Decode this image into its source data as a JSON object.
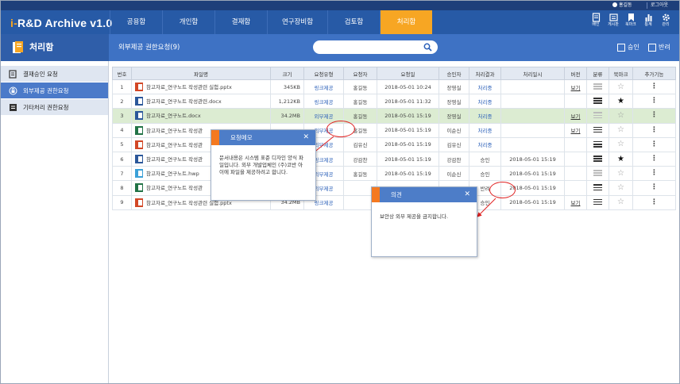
{
  "util": {
    "user": "홍길동",
    "logout": "로그아웃"
  },
  "header": {
    "logo": "i-R&D Archive v1.0",
    "tabs": [
      "공용함",
      "개인함",
      "결재함",
      "연구장비함",
      "검토함",
      "처리함"
    ],
    "tools": [
      "배인",
      "게시판",
      "북마크",
      "통계",
      "관리"
    ]
  },
  "subhead": {
    "section": "처리함",
    "page_title": "외부제공 권한요청(9)",
    "search_placeholder": "",
    "approve": "승인",
    "reject": "반려"
  },
  "sidebar": {
    "items": [
      {
        "label": "결재승인 요청",
        "icon": "approval-doc-icon"
      },
      {
        "label": "외부제공 권한요청",
        "icon": "lock-shield-icon"
      },
      {
        "label": "기타처리 권한요청",
        "icon": "list-doc-icon"
      }
    ]
  },
  "table": {
    "headers": [
      "번호",
      "파일명",
      "크기",
      "요청유형",
      "요청자",
      "요청일",
      "승인자",
      "처리결과",
      "처리일시",
      "버전",
      "분류",
      "북마크",
      "추가기능"
    ],
    "rows": [
      {
        "no": "1",
        "type": "ppt",
        "file": "참고자료_연구노트 작성관련 실험.pptx",
        "size": "345KB",
        "req_type": "링크제공",
        "requester": "홍길동",
        "req_date": "2018-05-01 10:24",
        "approver": "장영실",
        "result": "처리중",
        "proc_date": "",
        "version": "보기",
        "cls": "faint",
        "bookmark": "☆"
      },
      {
        "no": "2",
        "type": "doc",
        "file": "참고자료_연구노트 작성관련.docx",
        "size": "1,212KB",
        "req_type": "링크제공",
        "requester": "홍길동",
        "req_date": "2018-05-01 11:32",
        "approver": "장영실",
        "result": "처리중",
        "proc_date": "",
        "version": "",
        "cls": "dark",
        "bookmark": "★"
      },
      {
        "no": "3",
        "type": "doc",
        "file": "참고자료_연구노트.docx",
        "size": "34.2MB",
        "req_type": "외부제공",
        "requester": "홍길동",
        "req_date": "2018-05-01 15:19",
        "approver": "장영실",
        "result": "처리중",
        "proc_date": "",
        "version": "보기",
        "cls": "faint",
        "bookmark": "☆"
      },
      {
        "no": "4",
        "type": "xls",
        "file": "참고자료_연구노트 작성관",
        "size": "",
        "req_type": "외부제공",
        "requester": "홍길동",
        "req_date": "2018-05-01 15:19",
        "approver": "이순신",
        "result": "처리중",
        "proc_date": "",
        "version": "보기",
        "cls": "dark",
        "bookmark": "☆"
      },
      {
        "no": "5",
        "type": "ppt",
        "file": "참고자료_연구노트 작성관",
        "size": "",
        "req_type": "외부제공",
        "requester": "김유신",
        "req_date": "2018-05-01 15:19",
        "approver": "김유신",
        "result": "처리중",
        "proc_date": "",
        "version": "",
        "cls": "dark",
        "bookmark": "☆"
      },
      {
        "no": "6",
        "type": "doc",
        "file": "참고자료_연구노트 작성관",
        "size": "",
        "req_type": "링크제공",
        "requester": "강감찬",
        "req_date": "2018-05-01 15:19",
        "approver": "강감찬",
        "result": "승인",
        "proc_date": "2018-05-01 15:19",
        "version": "",
        "cls": "dark",
        "bookmark": "★"
      },
      {
        "no": "7",
        "type": "hwp",
        "file": "참고자료_연구노트.hwp",
        "size": "",
        "req_type": "외부제공",
        "requester": "홍길동",
        "req_date": "2018-05-01 15:19",
        "approver": "이순신",
        "result": "승인",
        "proc_date": "2018-05-01 15:19",
        "version": "",
        "cls": "faint",
        "bookmark": "☆"
      },
      {
        "no": "8",
        "type": "xls",
        "file": "참고자료_연구노트 작성관",
        "size": "",
        "req_type": "외부제공",
        "requester": "",
        "req_date": "",
        "approver": "",
        "result": "반려",
        "proc_date": "2018-05-01 15:19",
        "version": "",
        "cls": "dark",
        "bookmark": "☆"
      },
      {
        "no": "9",
        "type": "ppt",
        "file": "참고자료_연구노트 작성관련 실험.pptx",
        "size": "34.2MB",
        "req_type": "링크제공",
        "requester": "",
        "req_date": "",
        "approver": "",
        "result": "승인",
        "proc_date": "2018-05-01 15:19",
        "version": "보기",
        "cls": "dark",
        "bookmark": "☆"
      }
    ]
  },
  "memo_popup": {
    "title": "요청메모",
    "body": "문서내용은 시스템 표준 디자인 양식 파일입니다. 외부 개발업체인 (주)코반 아이에 파일을 제공하려고 합니다."
  },
  "opinion_popup": {
    "title": "의견",
    "body": "보안상 외부 제공을 금지합니다."
  },
  "colors": {
    "header": "#275aa6",
    "accent": "#f7a623",
    "popup_accent": "#f47920",
    "highlight_row": "#dcecd2"
  }
}
